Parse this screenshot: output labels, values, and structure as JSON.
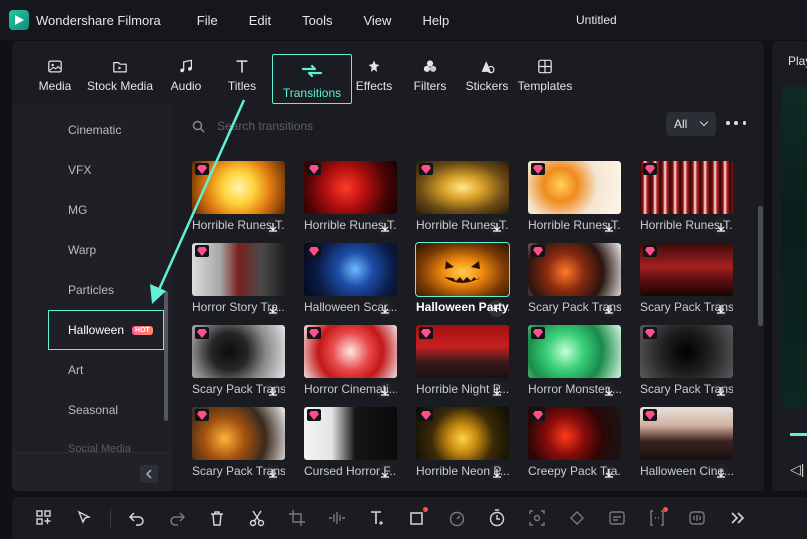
{
  "app": {
    "name": "Wondershare Filmora",
    "document_title": "Untitled"
  },
  "menu": [
    "File",
    "Edit",
    "Tools",
    "View",
    "Help"
  ],
  "toolbar": [
    {
      "label": "Media",
      "icon": "media-icon"
    },
    {
      "label": "Stock Media",
      "icon": "stock-media-icon"
    },
    {
      "label": "Audio",
      "icon": "audio-icon"
    },
    {
      "label": "Titles",
      "icon": "titles-icon"
    },
    {
      "label": "Transitions",
      "icon": "transitions-icon",
      "active": true
    },
    {
      "label": "Effects",
      "icon": "effects-icon"
    },
    {
      "label": "Filters",
      "icon": "filters-icon"
    },
    {
      "label": "Stickers",
      "icon": "stickers-icon"
    },
    {
      "label": "Templates",
      "icon": "templates-icon"
    }
  ],
  "sidebar": {
    "categories": [
      "Cinematic",
      "VFX",
      "MG",
      "Warp",
      "Particles",
      "Halloween",
      "Art",
      "Seasonal",
      "Social Media"
    ],
    "active": "Halloween",
    "hot_badge": "HOT"
  },
  "search": {
    "placeholder": "Search transitions"
  },
  "filter": {
    "value": "All"
  },
  "right_panel": {
    "tab": "Play"
  },
  "transitions": [
    {
      "label": "Horrible Runes T...",
      "premium": true,
      "download": true
    },
    {
      "label": "Horrible Runes T...",
      "premium": true,
      "download": true
    },
    {
      "label": "Horrible Runes T...",
      "premium": true,
      "download": true
    },
    {
      "label": "Horrible Runes T...",
      "premium": true,
      "download": true
    },
    {
      "label": "Horrible Runes T...",
      "premium": true,
      "download": true
    },
    {
      "label": "Horror Story Tra...",
      "premium": true,
      "download": true
    },
    {
      "label": "Halloween Scar...",
      "premium": true,
      "download": true
    },
    {
      "label": "Halloween Party...",
      "premium": false,
      "download": false,
      "selected": true
    },
    {
      "label": "Scary Pack Trans...",
      "premium": true,
      "download": true
    },
    {
      "label": "Scary Pack Trans...",
      "premium": true,
      "download": true
    },
    {
      "label": "Scary Pack Trans...",
      "premium": true,
      "download": true
    },
    {
      "label": "Horror Cinemati...",
      "premium": true,
      "download": true
    },
    {
      "label": "Horrible Night P...",
      "premium": true,
      "download": true
    },
    {
      "label": "Horror Monster ...",
      "premium": true,
      "download": true
    },
    {
      "label": "Scary Pack Trans...",
      "premium": true,
      "download": true
    },
    {
      "label": "Scary Pack Trans...",
      "premium": true,
      "download": true
    },
    {
      "label": "Cursed Horror F...",
      "premium": true,
      "download": true
    },
    {
      "label": "Horrible Neon P...",
      "premium": true,
      "download": true
    },
    {
      "label": "Creepy  Pack Tra...",
      "premium": true,
      "download": true
    },
    {
      "label": "Halloween Cine...",
      "premium": true,
      "download": true
    }
  ],
  "colors": {
    "accent": "#5ff0d6",
    "premium": "#ff4d8d",
    "background": "#1a1c21"
  },
  "bottom_toolbar": [
    "layout-icon",
    "select-icon",
    "undo-icon",
    "redo-icon",
    "delete-icon",
    "cut-icon",
    "crop-icon",
    "audio-stretch-icon",
    "text-icon",
    "shape-icon",
    "speed-icon",
    "timer-icon",
    "freeze-icon",
    "color-icon",
    "caption-icon",
    "bracket-icon",
    "voice-icon",
    "more-icon"
  ]
}
